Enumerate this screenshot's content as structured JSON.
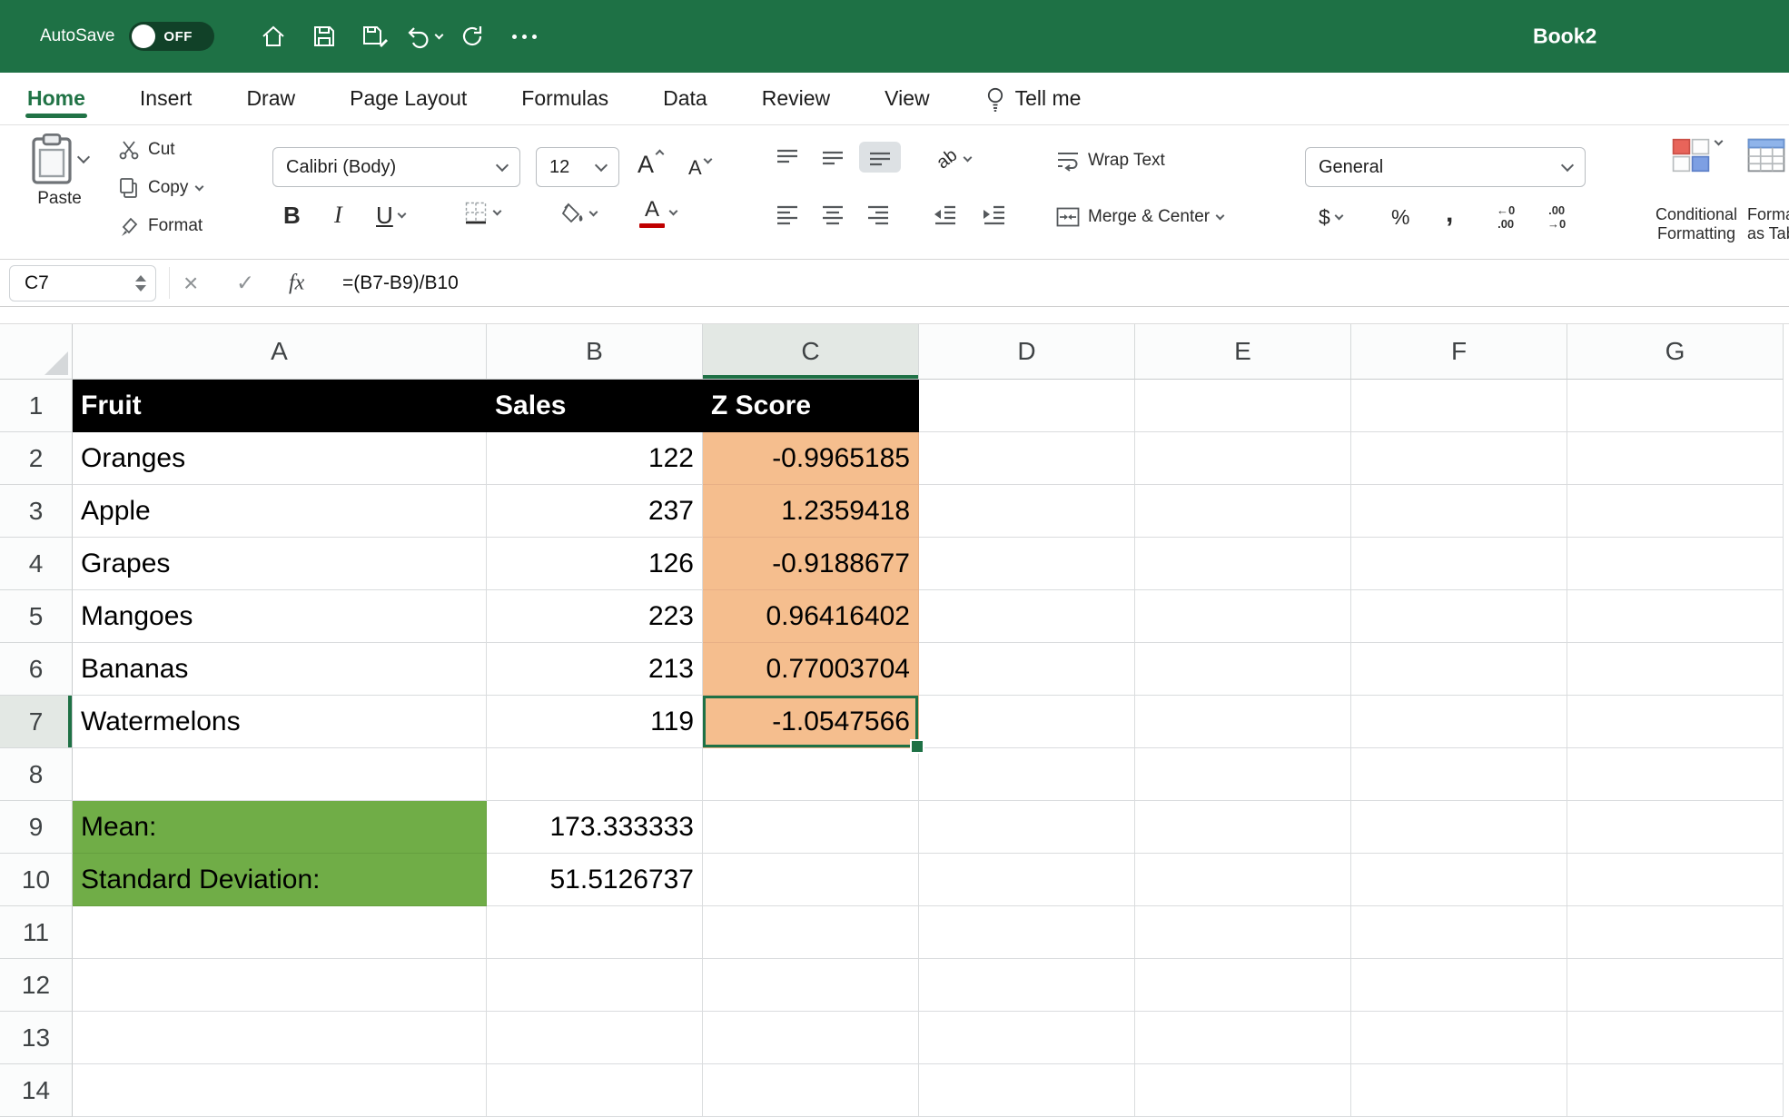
{
  "colors": {
    "titlebar_green": "#1E7145",
    "accent_green": "#217346",
    "selection_green": "#1E7145",
    "zscore_fill": "#F5BE8E",
    "label_fill": "#70AD47",
    "table_header_fill": "#000000",
    "table_header_text": "#FFFFFF"
  },
  "titlebar": {
    "autosave_label": "AutoSave",
    "autosave_state": "OFF",
    "workbook_title": "Book2"
  },
  "tabs": [
    {
      "label": "Home",
      "active": true
    },
    {
      "label": "Insert"
    },
    {
      "label": "Draw"
    },
    {
      "label": "Page Layout"
    },
    {
      "label": "Formulas"
    },
    {
      "label": "Data"
    },
    {
      "label": "Review"
    },
    {
      "label": "View"
    }
  ],
  "tell_me": {
    "label": "Tell me"
  },
  "ribbon": {
    "clipboard": {
      "paste": "Paste",
      "cut": "Cut",
      "copy": "Copy",
      "format": "Format"
    },
    "font": {
      "name": "Calibri (Body)",
      "size": "12",
      "bold": "B",
      "italic": "I",
      "underline": "U",
      "grow": "A",
      "shrink": "A",
      "color": "A"
    },
    "alignment": {
      "wrap_text": "Wrap Text",
      "merge_center": "Merge & Center",
      "orientation": "ab"
    },
    "number": {
      "format": "General",
      "currency": "$",
      "percent": "%",
      "comma": ",",
      "inc_decimal": [
        "←0",
        ".00"
      ],
      "dec_decimal": [
        ".00",
        "→0"
      ]
    },
    "styles": {
      "conditional": [
        "Conditional",
        "Formatting"
      ],
      "format_table": [
        "Format",
        "as Table"
      ]
    }
  },
  "formula_bar": {
    "name_box": "C7",
    "cancel": "×",
    "enter": "✓",
    "fx": "fx",
    "formula": "=(B7-B9)/B10"
  },
  "grid": {
    "columns": [
      "A",
      "B",
      "C",
      "D",
      "E",
      "F",
      "G"
    ],
    "selected_cell": "C7",
    "selected_column": "C",
    "selected_row": 7,
    "rows": [
      {
        "n": 1,
        "A": "Fruit",
        "B": "Sales",
        "C": "Z Score"
      },
      {
        "n": 2,
        "A": "Oranges",
        "B": "122",
        "C": "-0.9965185"
      },
      {
        "n": 3,
        "A": "Apple",
        "B": "237",
        "C": "1.2359418"
      },
      {
        "n": 4,
        "A": "Grapes",
        "B": "126",
        "C": "-0.9188677"
      },
      {
        "n": 5,
        "A": "Mangoes",
        "B": "223",
        "C": "0.96416402"
      },
      {
        "n": 6,
        "A": "Bananas",
        "B": "213",
        "C": "0.77003704"
      },
      {
        "n": 7,
        "A": "Watermelons",
        "B": "119",
        "C": "-1.0547566"
      },
      {
        "n": 8
      },
      {
        "n": 9,
        "A": "Mean:",
        "B": "173.333333"
      },
      {
        "n": 10,
        "A": "Standard Deviation:",
        "B": "51.5126737"
      },
      {
        "n": 11
      },
      {
        "n": 12
      },
      {
        "n": 13
      },
      {
        "n": 14
      }
    ]
  }
}
